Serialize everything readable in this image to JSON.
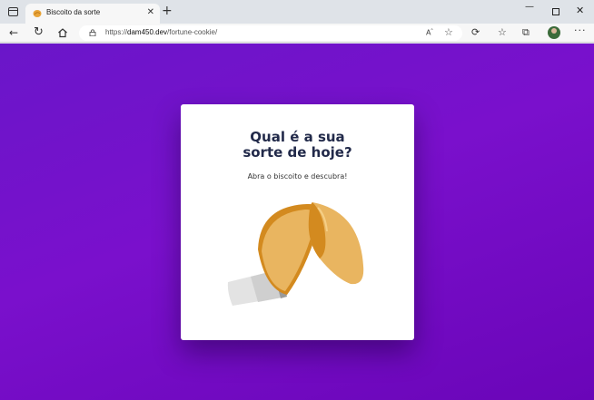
{
  "browser": {
    "tab_title": "Biscoito da sorte",
    "url_prefix": "https://",
    "url_host": "dam450.dev",
    "url_path": "/fortune-cookie/",
    "new_tab_symbol": "+",
    "close_symbol": "✕",
    "icons": [
      "window-menu-icon",
      "back-icon",
      "reload-icon",
      "home-icon",
      "lock-icon",
      "read-aloud-icon",
      "add-favorite-icon",
      "extensions-icon",
      "favorites-icon",
      "collections-icon",
      "more-icon"
    ]
  },
  "page": {
    "title": "Qual é a sua sorte de hoje?",
    "subtitle": "Abra o biscoito e descubra!",
    "background_colors": [
      "#6a16c9",
      "#7a10cc",
      "#6a05b8"
    ],
    "cookie_colors": {
      "light": "#e9b560",
      "dark": "#d38a1f",
      "paper": "#e3e3e3"
    }
  }
}
